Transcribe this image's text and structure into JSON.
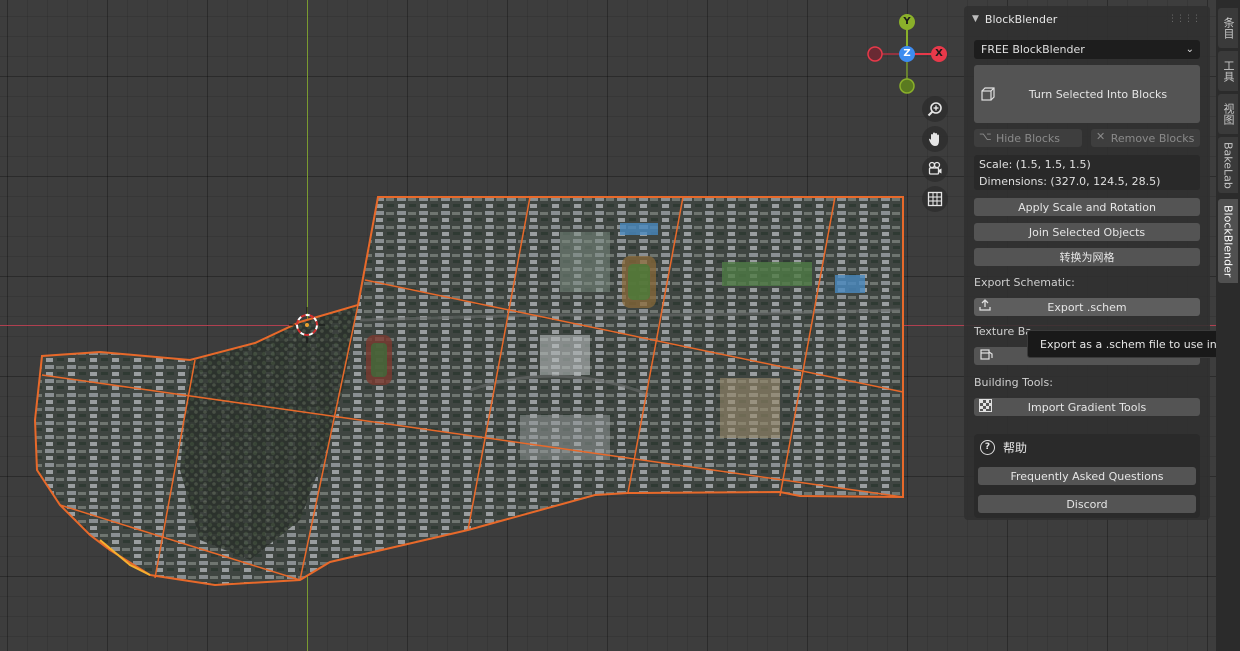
{
  "gizmo": {
    "y_label": "Y",
    "z_label": "Z",
    "x_label": "X"
  },
  "panel": {
    "title": "BlockBlender",
    "version_select": "FREE BlockBlender",
    "turn_into_blocks": "Turn Selected Into Blocks",
    "hide_blocks": "Hide Blocks",
    "remove_blocks": "Remove Blocks",
    "scale_text": "Scale: (1.5, 1.5, 1.5)",
    "dimensions_text": "Dimensions: (327.0, 124.5, 28.5)",
    "apply_scale": "Apply Scale and Rotation",
    "join_selected": "Join Selected Objects",
    "convert_mesh": "转换为网格",
    "export_schematic_label": "Export Schematic:",
    "export_schem": "Export .schem",
    "texture_label": "Texture Ba",
    "building_tools_label": "Building Tools:",
    "import_gradient": "Import Gradient Tools",
    "help_title": "帮助",
    "faq": "Frequently Asked Questions",
    "discord": "Discord"
  },
  "tooltip": "Export as a .schem file to use in Minec",
  "tabs": [
    "条目",
    "工具",
    "视图",
    "BakeLab",
    "BlockBlender"
  ],
  "colors": {
    "selection_outline": "#e8692a",
    "x_axis": "#b04050",
    "y_axis": "#7a9a30",
    "gizmo_x": "#e8394a",
    "gizmo_y": "#8ab02a",
    "gizmo_z": "#3d8cf0"
  }
}
